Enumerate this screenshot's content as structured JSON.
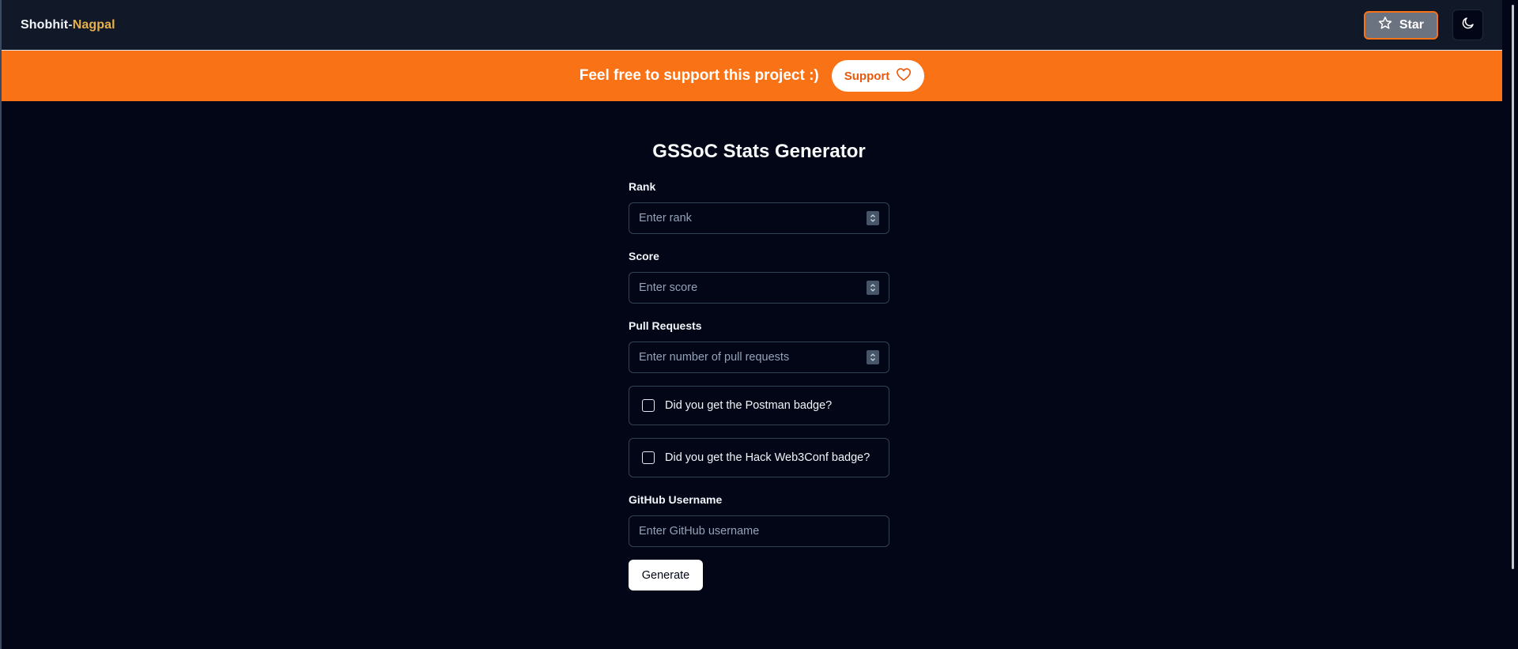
{
  "navbar": {
    "brand_first": "Shobhit",
    "brand_sep": "-",
    "brand_last": "Nagpal",
    "star_label": "Star",
    "star_icon": "star-icon",
    "theme_icon": "moon-icon"
  },
  "banner": {
    "text": "Feel free to support this project :)",
    "support_label": "Support",
    "support_icon": "heart-icon"
  },
  "form": {
    "title": "GSSoC Stats Generator",
    "rank": {
      "label": "Rank",
      "placeholder": "Enter rank",
      "value": ""
    },
    "score": {
      "label": "Score",
      "placeholder": "Enter score",
      "value": ""
    },
    "pull_requests": {
      "label": "Pull Requests",
      "placeholder": "Enter number of pull requests",
      "value": ""
    },
    "postman_badge": {
      "label": "Did you get the Postman badge?",
      "checked": false
    },
    "web3conf_badge": {
      "label": "Did you get the Hack Web3Conf badge?",
      "checked": false
    },
    "github": {
      "label": "GitHub Username",
      "placeholder": "Enter GitHub username",
      "value": ""
    },
    "generate_label": "Generate"
  },
  "colors": {
    "background": "#020617",
    "navbar": "#111827",
    "banner": "#f97316",
    "accent_text": "#e7b04a",
    "star_button": "#6b7280"
  }
}
